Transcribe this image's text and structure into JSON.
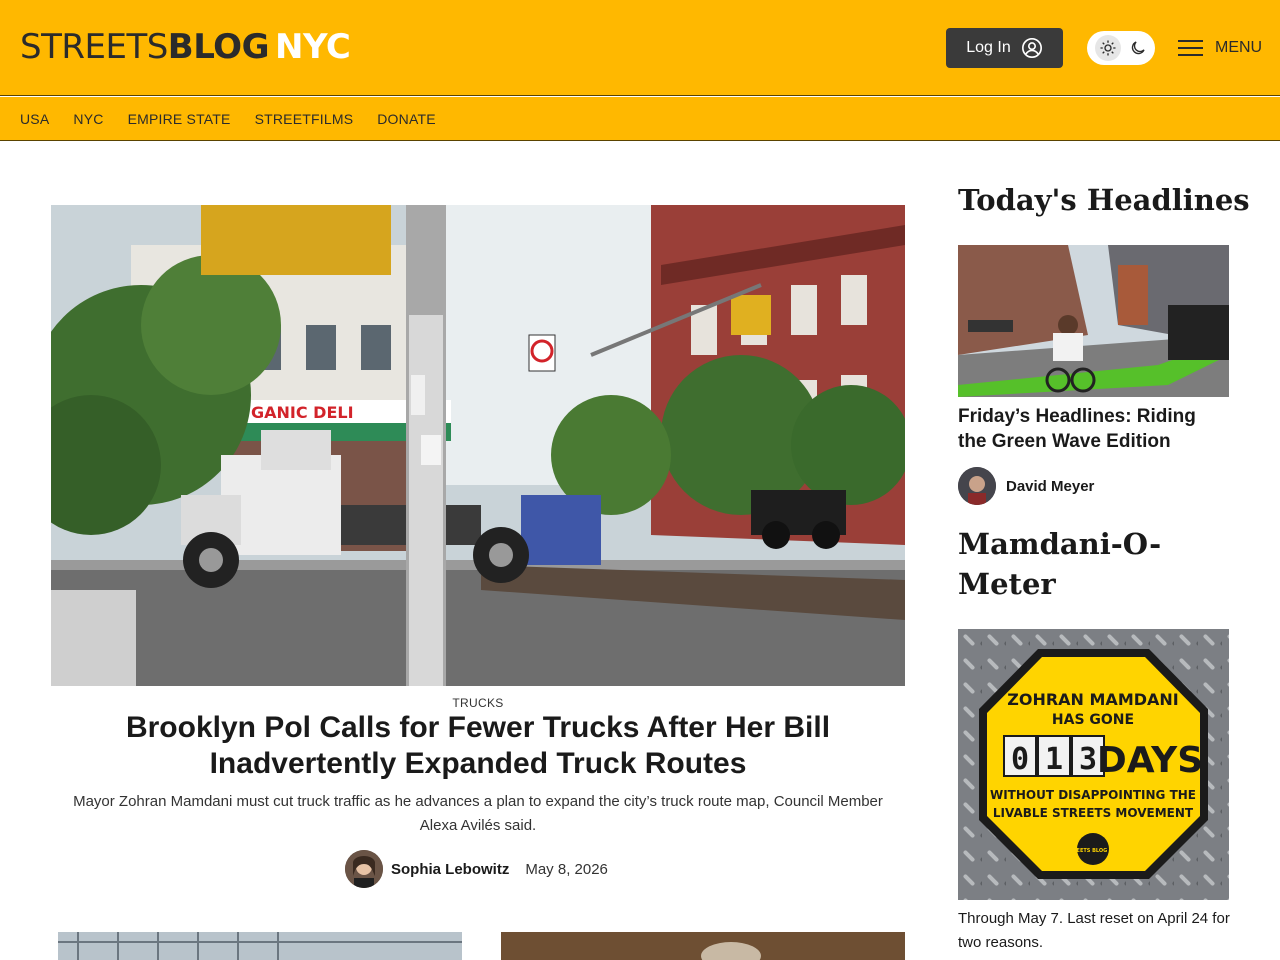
{
  "header": {
    "logo_thin": "STREETS",
    "logo_bold": "BLOG",
    "logo_city": "NYC",
    "login_label": "Log In",
    "menu_label": "MENU"
  },
  "nav": {
    "items": [
      "USA",
      "NYC",
      "EMPIRE STATE",
      "STREETFILMS",
      "DONATE"
    ]
  },
  "feature": {
    "category": "TRUCKS",
    "headline": "Brooklyn Pol Calls for Fewer Trucks After Her Bill Inadvertently Expanded Truck Routes",
    "dek": "Mayor Zohran Mamdani must cut truck traffic as he advances a plan to expand the city’s truck route map, Council Member Alexa Avilés said.",
    "author": "Sophia Lebowitz",
    "date": "May 8, 2026",
    "image_sign_deli": "GANIC DELI"
  },
  "sidebar": {
    "headlines_title": "Today's Headlines",
    "story_title": "Friday’s Headlines: Riding the Green Wave Edition",
    "story_author": "David Meyer",
    "meter_title": "Mamdani-O-Meter",
    "meter": {
      "line1": "ZOHRAN MAMDANI",
      "line2": "HAS GONE",
      "digits": [
        "0",
        "1",
        "3"
      ],
      "unit": "DAYS",
      "line3": "WITHOUT DISAPPOINTING THE",
      "line4": "LIVABLE STREETS MOVEMENT",
      "badge": "STREETS BLOG NYC"
    },
    "meter_caption": "Through May 7. Last reset on April 24 for two reasons."
  },
  "colors": {
    "brand_yellow": "#ffb800",
    "dark_button": "#3a3a3a",
    "sign_yellow": "#ffd400"
  }
}
